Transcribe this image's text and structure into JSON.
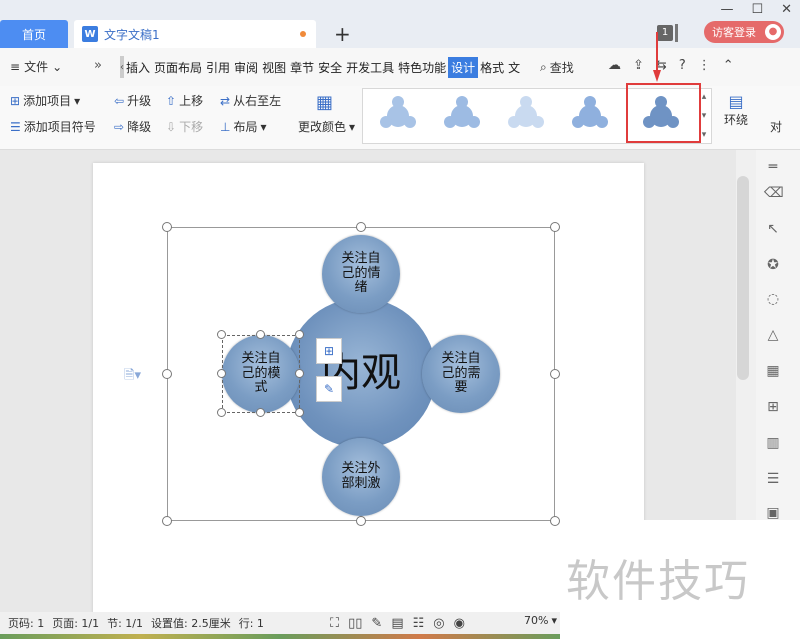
{
  "titlebar": {
    "home_tab": "首页",
    "doc_icon": "W",
    "doc_title": "文字文稿1",
    "new_tab": "+",
    "badge_count": "1",
    "login_label": "访客登录",
    "avatar_icon": "user-icon",
    "window_controls": {
      "minimize": "—",
      "maximize": "☐",
      "close": "✕"
    }
  },
  "menubar": {
    "file_icon": "≡",
    "file_label": "文件",
    "more": "»",
    "scroll_left": "‹",
    "scroll_right": "›",
    "tabs": [
      "插入",
      "页面布局",
      "引用",
      "审阅",
      "视图",
      "章节",
      "安全",
      "开发工具",
      "特色功能",
      "设计",
      "格式",
      "文"
    ],
    "active_tab": "设计",
    "search_label": "查找",
    "right_tools": [
      "cloud-icon",
      "share-icon",
      "sync-icon",
      "help-icon",
      "more-icon",
      "collapse-icon"
    ]
  },
  "ribbon": {
    "add_item": "添加项目",
    "add_bullet": "添加项目符号",
    "promote": "升级",
    "demote": "降级",
    "move_up": "上移",
    "move_down": "下移",
    "right_to_left": "从右至左",
    "layout": "布局",
    "change_color": "更改颜色",
    "wrap": "环绕",
    "align": "对"
  },
  "gallery": {
    "items": [
      "style-1",
      "style-2",
      "style-3",
      "style-4",
      "style-5"
    ],
    "selected_index": 4
  },
  "diagram": {
    "center_text": "内观",
    "top": "关注自己的情绪",
    "left": "关注自己的模式",
    "right": "关注自己的需要",
    "bottom": "关注外部刺激"
  },
  "statusbar": {
    "page_num": "页码: 1",
    "pages": "页面: 1/1",
    "section": "节: 1/1",
    "setting": "设置值: 2.5厘米",
    "line": "行: 1",
    "zoom": "70%",
    "zoom_arrow": "▾"
  },
  "watermark": "软件技巧"
}
